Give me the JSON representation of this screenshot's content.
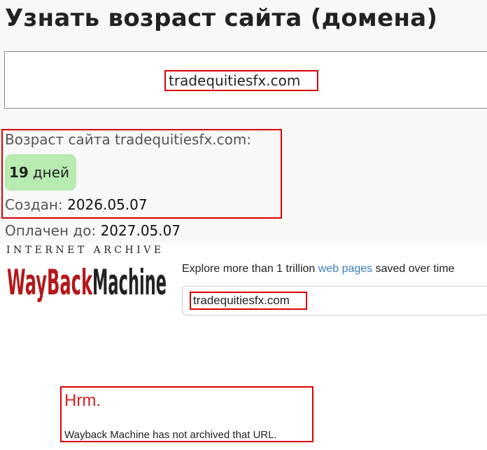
{
  "page": {
    "title": "Узнать возраст сайта (домена)"
  },
  "domain_input": {
    "value": "tradequitiesfx.com"
  },
  "result": {
    "age_label": "Возраст сайта tradequitiesfx.com:",
    "age_number": "19",
    "age_unit": "дней",
    "created_label": "Создан:",
    "created_value": "2026.05.07",
    "paid_label": "Оплачен до:",
    "paid_value": "2027.05.07"
  },
  "wayback": {
    "top_text": "INTERNET ARCHIVE",
    "logo_text": "WaybackMachine",
    "explore_prefix": "Explore more than 1 trillion",
    "explore_link": "web pages",
    "explore_suffix": "saved over time",
    "search_value": "tradequitiesfx.com",
    "error_title": "Hrm.",
    "error_message": "Wayback Machine has not archived that URL."
  },
  "colors": {
    "highlight_border": "#dd0000",
    "badge_bg": "#b7ebb0",
    "wayback_red": "#b3181a",
    "link_blue": "#3b7cc0",
    "error_red": "#d42020"
  }
}
